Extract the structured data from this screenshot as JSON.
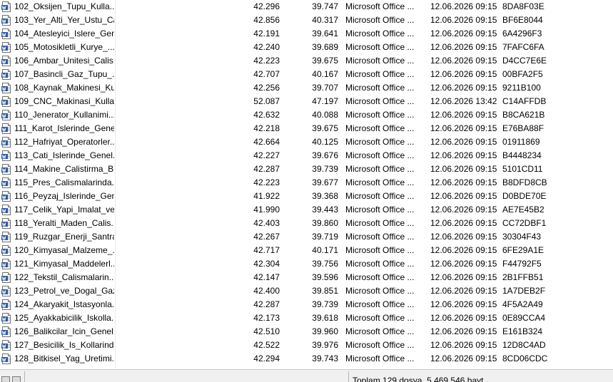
{
  "files": [
    {
      "name": "102_Oksijen_Tupu_Kulla...",
      "packed": "42.296",
      "size": "39.747",
      "method": "Microsoft Office ...",
      "modified": "12.06.2026 09:15",
      "crc": "8DA8F03E"
    },
    {
      "name": "103_Yer_Alti_Yer_Ustu_Ca...",
      "packed": "42.856",
      "size": "40.317",
      "method": "Microsoft Office ...",
      "modified": "12.06.2026 09:15",
      "crc": "BF6E8044"
    },
    {
      "name": "104_Atesleyici_Islere_Gen...",
      "packed": "42.191",
      "size": "39.641",
      "method": "Microsoft Office ...",
      "modified": "12.06.2026 09:15",
      "crc": "6A4296F3"
    },
    {
      "name": "105_Motosikletli_Kurye_...",
      "packed": "42.240",
      "size": "39.689",
      "method": "Microsoft Office ...",
      "modified": "12.06.2026 09:15",
      "crc": "7FAFC6FA"
    },
    {
      "name": "106_Ambar_Unitesi_Calis...",
      "packed": "42.223",
      "size": "39.675",
      "method": "Microsoft Office ...",
      "modified": "12.06.2026 09:15",
      "crc": "D4CC7E6E"
    },
    {
      "name": "107_Basincli_Gaz_Tupu_...",
      "packed": "42.707",
      "size": "40.167",
      "method": "Microsoft Office ...",
      "modified": "12.06.2026 09:15",
      "crc": "00BFA2F5"
    },
    {
      "name": "108_Kaynak_Makinesi_Ku...",
      "packed": "42.256",
      "size": "39.707",
      "method": "Microsoft Office ...",
      "modified": "12.06.2026 09:15",
      "crc": "9211B100"
    },
    {
      "name": "109_CNC_Makinasi_Kulla...",
      "packed": "52.087",
      "size": "47.197",
      "method": "Microsoft Office ...",
      "modified": "12.06.2026 13:42",
      "crc": "C14AFFDB"
    },
    {
      "name": "110_Jenerator_Kullanimi...",
      "packed": "42.632",
      "size": "40.088",
      "method": "Microsoft Office ...",
      "modified": "12.06.2026 09:15",
      "crc": "B8CA621B"
    },
    {
      "name": "111_Karot_Islerinde_Gene...",
      "packed": "42.218",
      "size": "39.675",
      "method": "Microsoft Office ...",
      "modified": "12.06.2026 09:15",
      "crc": "E76BA88F"
    },
    {
      "name": "112_Hafriyat_Operatorler...",
      "packed": "42.664",
      "size": "40.125",
      "method": "Microsoft Office ...",
      "modified": "12.06.2026 09:15",
      "crc": "01911869"
    },
    {
      "name": "113_Cati_Islerinde_Genel...",
      "packed": "42.227",
      "size": "39.676",
      "method": "Microsoft Office ...",
      "modified": "12.06.2026 09:15",
      "crc": "B4448234"
    },
    {
      "name": "114_Makine_Calistirma_B...",
      "packed": "42.287",
      "size": "39.739",
      "method": "Microsoft Office ...",
      "modified": "12.06.2026 09:15",
      "crc": "5101CD11"
    },
    {
      "name": "115_Pres_Calismalarinda...",
      "packed": "42.223",
      "size": "39.677",
      "method": "Microsoft Office ...",
      "modified": "12.06.2026 09:15",
      "crc": "B8DFD8CB"
    },
    {
      "name": "116_Peyzaj_Islerinde_Gen...",
      "packed": "41.922",
      "size": "39.368",
      "method": "Microsoft Office ...",
      "modified": "12.06.2026 09:15",
      "crc": "D0BDE70E"
    },
    {
      "name": "117_Celik_Yapi_Imalat_ve...",
      "packed": "41.990",
      "size": "39.443",
      "method": "Microsoft Office ...",
      "modified": "12.06.2026 09:15",
      "crc": "AE7E45B2"
    },
    {
      "name": "118_Yeralti_Maden_Calis...",
      "packed": "42.403",
      "size": "39.860",
      "method": "Microsoft Office ...",
      "modified": "12.06.2026 09:15",
      "crc": "CC72DBF1"
    },
    {
      "name": "119_Ruzgar_Enerji_Santra...",
      "packed": "42.267",
      "size": "39.719",
      "method": "Microsoft Office ...",
      "modified": "12.06.2026 09:15",
      "crc": "30304F43"
    },
    {
      "name": "120_Kimyasal_Malzeme_...",
      "packed": "42.717",
      "size": "40.171",
      "method": "Microsoft Office ...",
      "modified": "12.06.2026 09:15",
      "crc": "6FE29A1E"
    },
    {
      "name": "121_Kimyasal_Maddelerl...",
      "packed": "42.304",
      "size": "39.756",
      "method": "Microsoft Office ...",
      "modified": "12.06.2026 09:15",
      "crc": "F44792F5"
    },
    {
      "name": "122_Tekstil_Calismalarin...",
      "packed": "42.147",
      "size": "39.596",
      "method": "Microsoft Office ...",
      "modified": "12.06.2026 09:15",
      "crc": "2B1FFB51"
    },
    {
      "name": "123_Petrol_ve_Dogal_Gaz...",
      "packed": "42.400",
      "size": "39.851",
      "method": "Microsoft Office ...",
      "modified": "12.06.2026 09:15",
      "crc": "1A7DEB2F"
    },
    {
      "name": "124_Akaryakit_Istasyonla...",
      "packed": "42.287",
      "size": "39.739",
      "method": "Microsoft Office ...",
      "modified": "12.06.2026 09:15",
      "crc": "4F5A2A49"
    },
    {
      "name": "125_Ayakkabicilik_Iskolla...",
      "packed": "42.173",
      "size": "39.618",
      "method": "Microsoft Office ...",
      "modified": "12.06.2026 09:15",
      "crc": "0E89CCA4"
    },
    {
      "name": "126_Balikcilar_Icin_Genel...",
      "packed": "42.510",
      "size": "39.960",
      "method": "Microsoft Office ...",
      "modified": "12.06.2026 09:15",
      "crc": "E161B324"
    },
    {
      "name": "127_Besicilik_Is_Kollarind...",
      "packed": "42.522",
      "size": "39.976",
      "method": "Microsoft Office ...",
      "modified": "12.06.2026 09:15",
      "crc": "12D8C4AD"
    },
    {
      "name": "128_Bitkisel_Yag_Uretimi...",
      "packed": "42.294",
      "size": "39.743",
      "method": "Microsoft Office ...",
      "modified": "12.06.2026 09:15",
      "crc": "8CD06CDC"
    }
  ],
  "status": {
    "summary": "Toplam 129 dosya, 5.469.546 bayt"
  },
  "icons": {
    "file": "word-document-icon",
    "status_left": "drive-icon",
    "status_right": "lock-icon"
  },
  "colors": {
    "icon_blue": "#2b5797",
    "statusbar_bg": "#f0f0f0"
  }
}
